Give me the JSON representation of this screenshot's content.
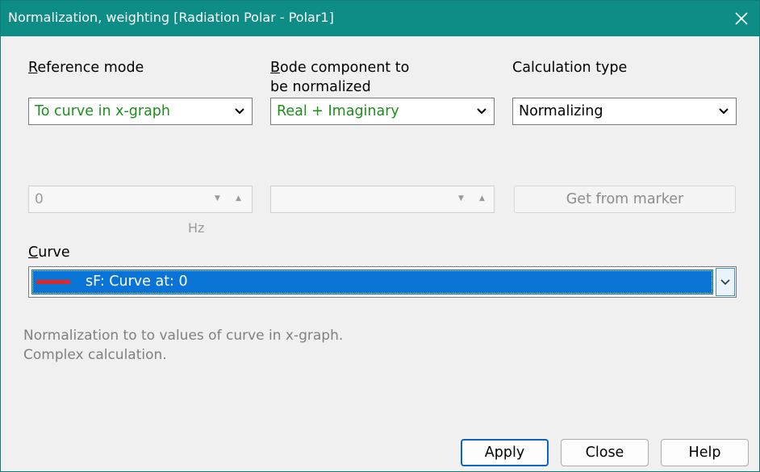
{
  "window": {
    "title": "Normalization, weighting  [Radiation Polar - Polar1]"
  },
  "reference_mode": {
    "label": "Reference mode",
    "selected": "To curve in x-graph"
  },
  "bode_component": {
    "label_line1": "Bode component to",
    "label_line2": "be normalized",
    "selected": "Real + Imaginary"
  },
  "calculation_type": {
    "label": "Calculation type",
    "selected": "Normalizing"
  },
  "frequency_field": {
    "value": "0",
    "unit": "Hz"
  },
  "secondary_field": {
    "value": ""
  },
  "get_from_marker": {
    "label": "Get from marker"
  },
  "curve": {
    "label": "Curve",
    "selected": "sF: Curve at: 0",
    "swatch_color": "#e22626"
  },
  "description": {
    "line1": "Normalization to to values of curve in x-graph.",
    "line2": "Complex calculation."
  },
  "buttons": {
    "apply": "Apply",
    "close": "Close",
    "help": "Help"
  },
  "colors": {
    "titlebar": "#0e8c86",
    "selection": "#0a74d6",
    "value_green": "#1b8f1b"
  }
}
